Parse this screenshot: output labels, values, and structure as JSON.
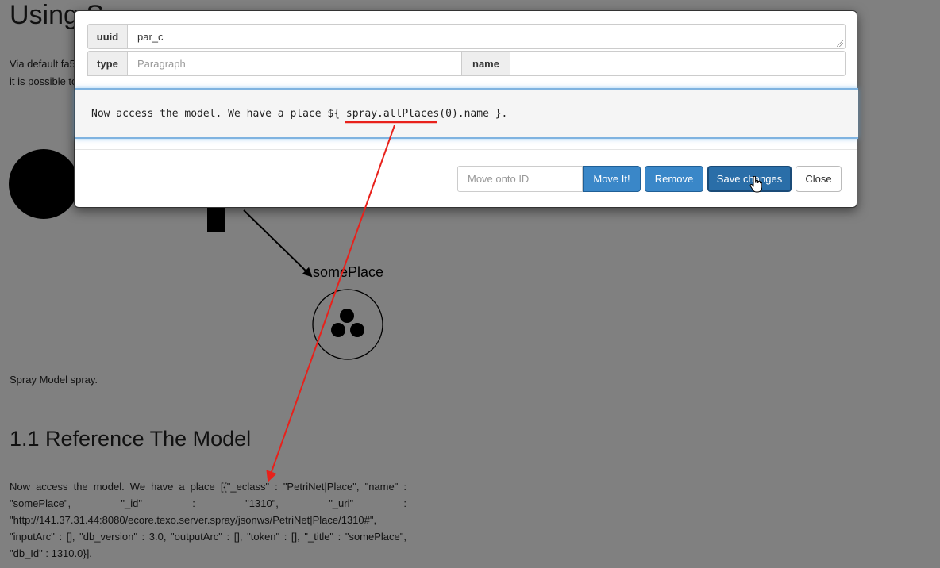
{
  "background": {
    "title": "Using S",
    "via_text": "Via default fa5",
    "possible_text": "it is possible to",
    "spray_text": "Spray Model spray.",
    "section_heading": "1.1 Reference The Model",
    "paragraph": "Now access the model. We have a place [{\"_eclass\" : \"PetriNet|Place\", \"name\" : \"somePlace\", \"_id\" : \"1310\", \"_uri\" : \"http://141.37.31.44:8080/ecore.texo.server.spray/jsonws/PetriNet|Place/1310#\", \"inputArc\" : [], \"db_version\" : 3.0, \"outputArc\" : [], \"token\" : [], \"_title\" : \"somePlace\", \"db_Id\" : 1310.0}].",
    "place_label": "somePlace",
    "token_count": 3
  },
  "modal": {
    "uuid_label": "uuid",
    "uuid_value": "par_c",
    "type_label": "type",
    "type_placeholder": "Paragraph",
    "name_label": "name",
    "name_value": "",
    "code_text": "Now access the model. We have a place ${ spray.allPlaces(0).name }.",
    "move_placeholder": "Move onto ID",
    "move_button": "Move It!",
    "remove_button": "Remove",
    "save_button": "Save changes",
    "close_button": "Close"
  },
  "annotation": {
    "color": "#e8211b",
    "type": "underline-arrow"
  },
  "icons": [
    "hand-cursor-icon",
    "resize-grip-icon",
    "arrow-head-icon"
  ]
}
